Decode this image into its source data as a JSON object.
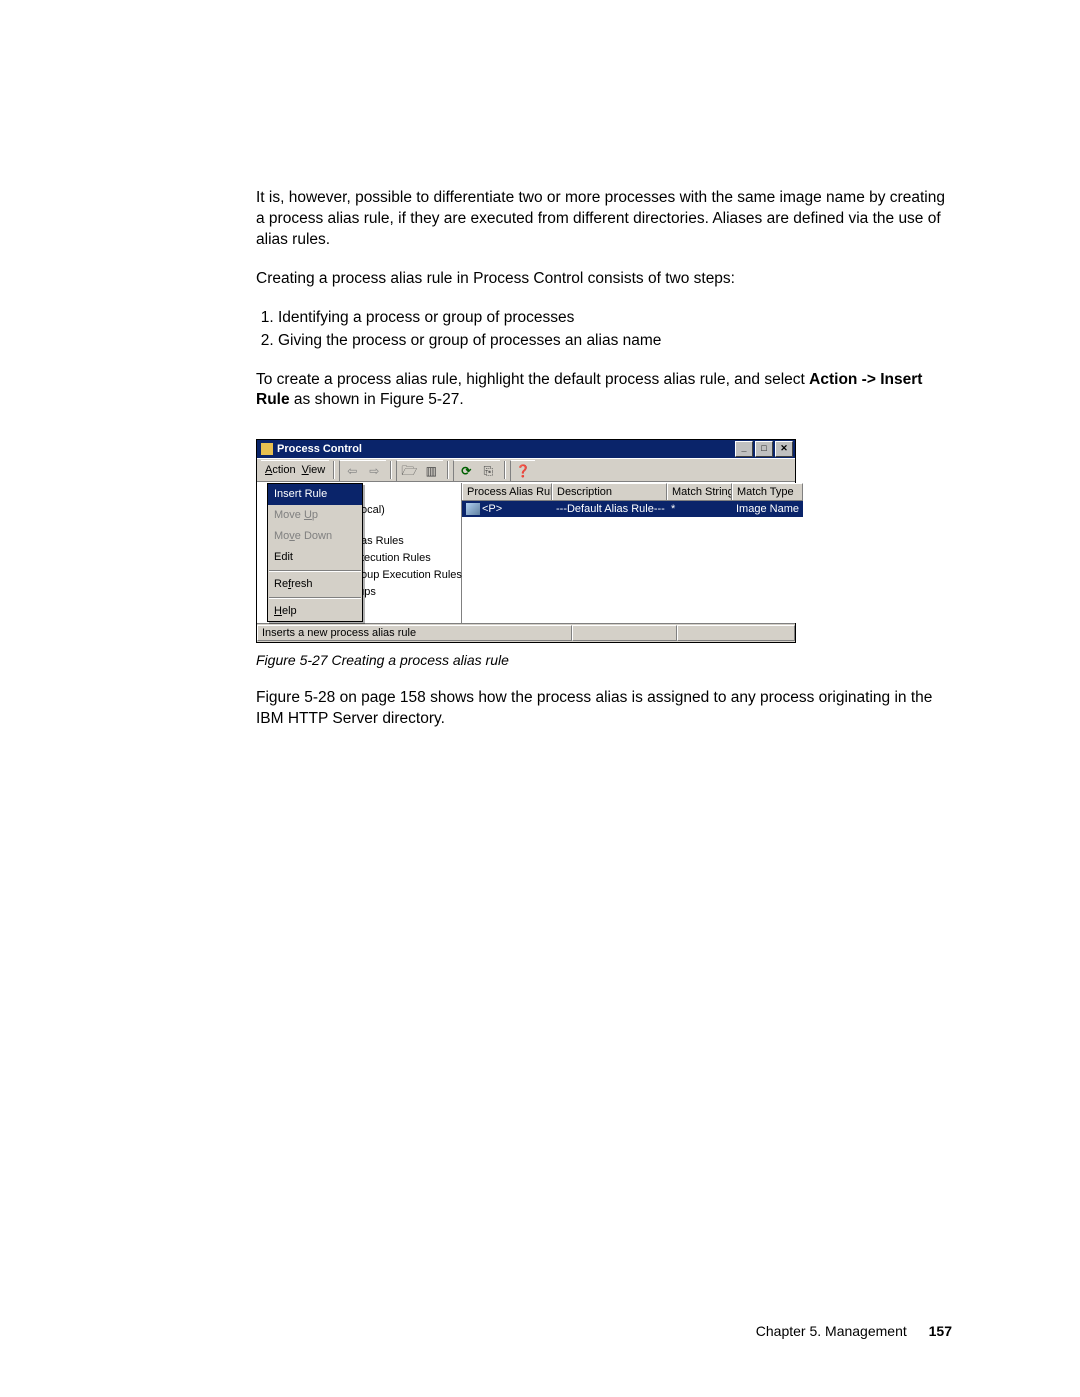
{
  "body": {
    "p1": "It is, however, possible to differentiate two or more processes with the same image name by creating a process alias rule, if they are executed from different directories. Aliases are defined via the use of alias rules.",
    "p2": "Creating a process alias rule in Process Control consists of two steps:",
    "step1": "Identifying a process or group of processes",
    "step2": "Giving the process or group of processes an alias name",
    "p3a": "To create a process alias rule, highlight the default process alias rule, and select ",
    "p3b": "Action -> Insert Rule",
    "p3c": " as shown in Figure 5-27.",
    "p4": "Figure 5-28 on page 158 shows how the process alias is assigned to any process originating in the IBM HTTP Server directory."
  },
  "caption": "Figure 5-27   Creating a process alias rule",
  "footer": {
    "chapter": "Chapter 5. Management",
    "page": "157"
  },
  "app": {
    "title": "Process Control",
    "menu": {
      "action": "Action",
      "view": "View"
    },
    "ctx": {
      "insert": "Insert Rule",
      "moveup": "Move Up",
      "movedown": "Move Down",
      "edit": "Edit",
      "refresh": "Refresh",
      "help": "Help"
    },
    "tree": {
      "local": "ocal)",
      "aliasRules": "as Rules",
      "execRules": "tecution Rules",
      "groupExecRules": "oup Execution Rules",
      "processGroups": "Process Groups"
    },
    "columns": {
      "c1": "Process Alias Rule",
      "c2": "Description",
      "c3": "Match String",
      "c4": "Match Type"
    },
    "row": {
      "rule": "<P>",
      "desc": "---Default Alias Rule---",
      "match": "*",
      "type": "Image Name"
    },
    "status": "Inserts a new process alias rule"
  }
}
